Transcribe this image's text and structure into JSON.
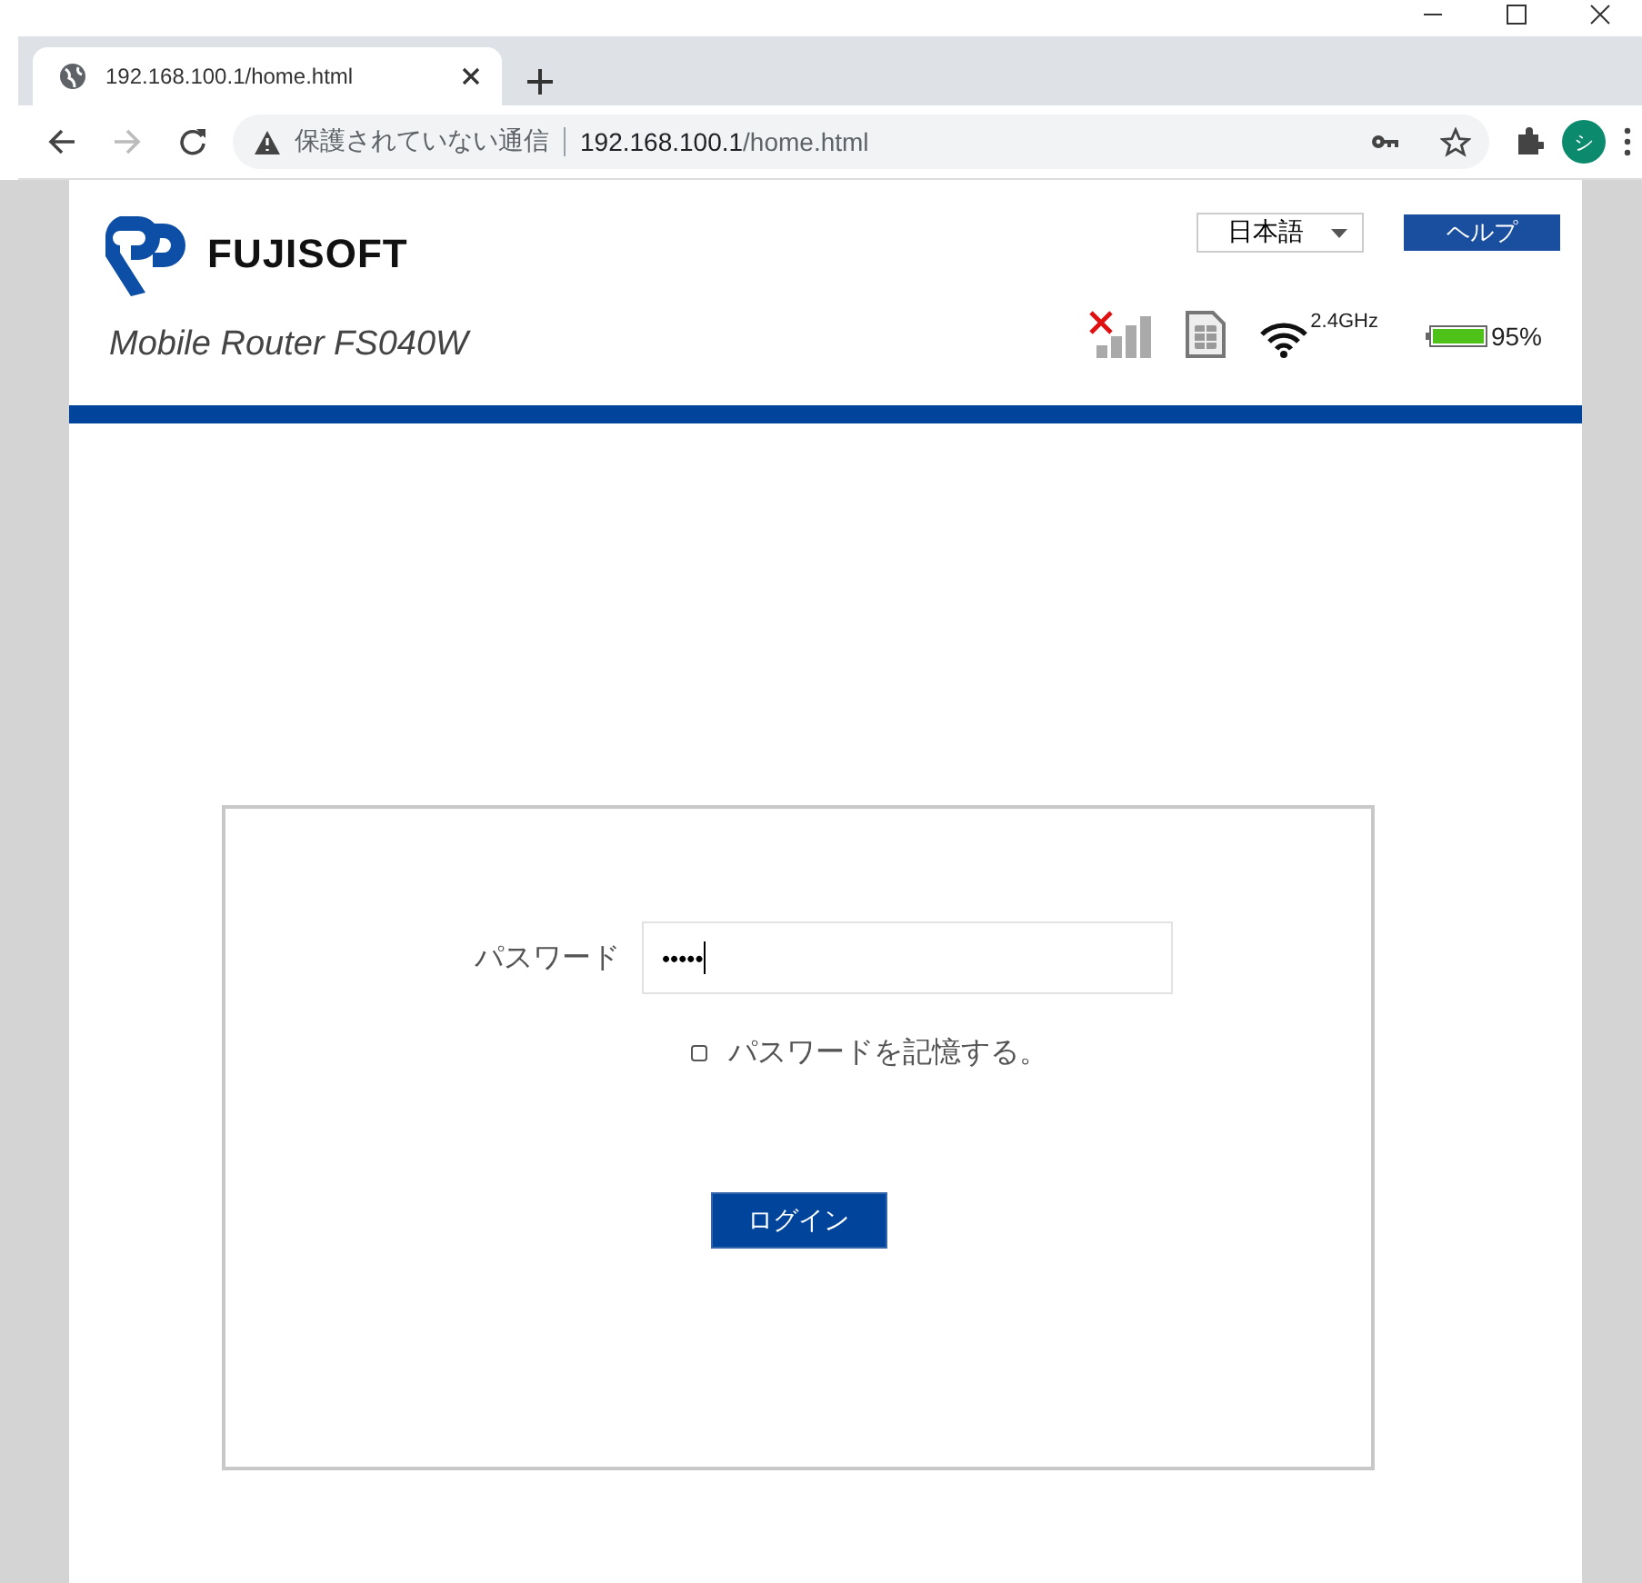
{
  "browser": {
    "tab": {
      "title": "192.168.100.1/home.html",
      "selected": true
    },
    "security_label": "保護されていない通信",
    "url_host": "192.168.100.1",
    "url_path": "/home.html",
    "profile_initial": "シ"
  },
  "header": {
    "brand": "FUJISOFT",
    "language": "日本語",
    "help_button": "ヘルプ",
    "model": "Mobile Router FS040W",
    "wifi_band": "2.4GHz",
    "battery_reading": "95%"
  },
  "login": {
    "password_label": "パスワード",
    "password_value": "•••••",
    "remember": {
      "label": "パスワードを記憶する。",
      "checked": false
    },
    "login_button": "ログイン"
  }
}
